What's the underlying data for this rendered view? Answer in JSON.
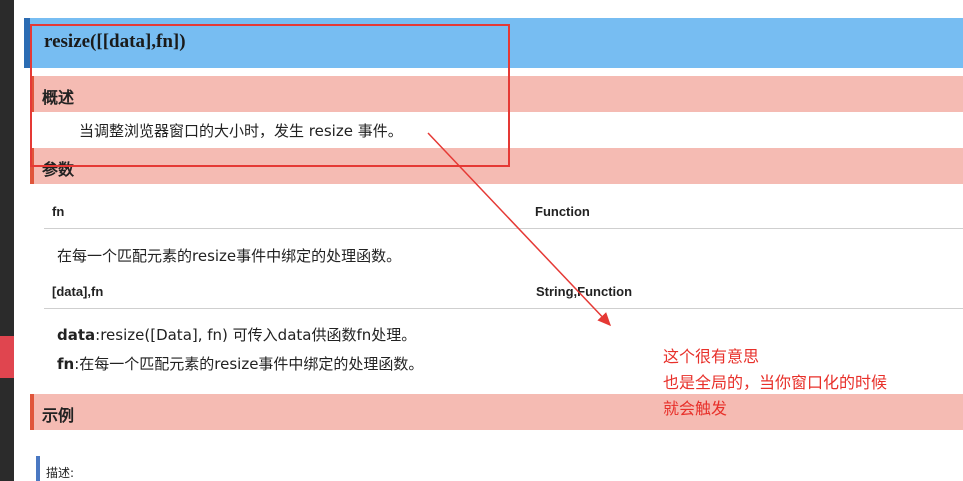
{
  "title": "resize([[data],fn])",
  "sections": {
    "overview": "概述",
    "params": "参数",
    "example": "示例"
  },
  "overview_text": "当调整浏览器窗口的大小时，发生 resize 事件。",
  "params": [
    {
      "name": "fn",
      "type": "Function",
      "desc": "在每一个匹配元素的resize事件中绑定的处理函数。"
    },
    {
      "name": "[data],fn",
      "type": "String,Function"
    }
  ],
  "param2_desc": {
    "line1_key": "data",
    "line1_rest": ":resize([Data], fn) 可传入data供函数fn处理。",
    "line2_key": "fn",
    "line2_rest": ":在每一个匹配元素的resize事件中绑定的处理函数。"
  },
  "annotation": [
    "这个很有意思",
    "也是全局的，当你窗口化的时候",
    "就会触发"
  ],
  "description_label": "描述:",
  "colors": {
    "title_bg": "#77bdf2",
    "section_bg": "#f5bbb3",
    "annotation": "#e8302a",
    "highlight_box": "#e53935"
  }
}
